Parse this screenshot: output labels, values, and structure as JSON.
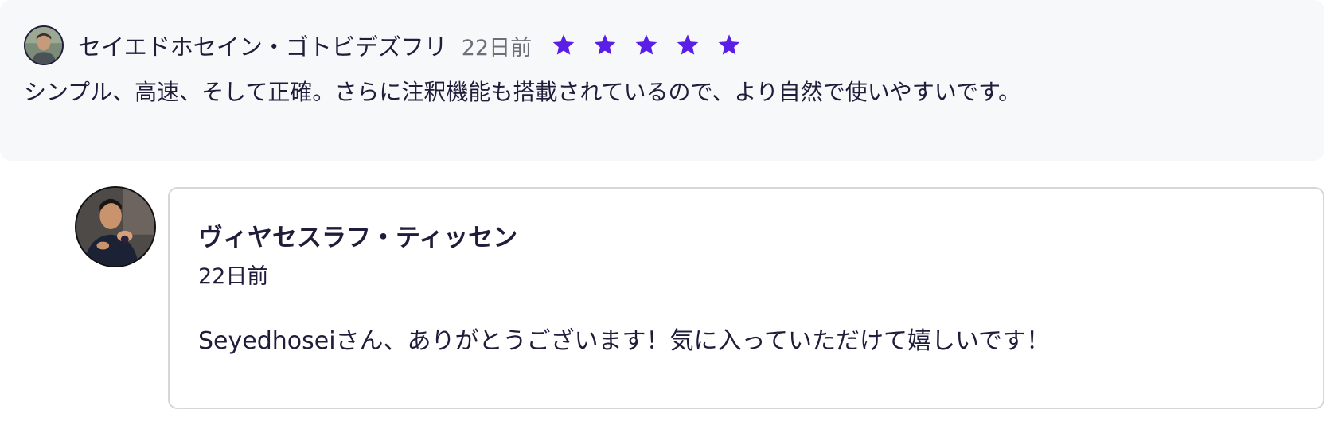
{
  "review": {
    "author": "セイエドホセイン・ゴトビデズフリ",
    "time": "22日前",
    "rating": 5,
    "rating_max": 5,
    "star_color": "#5b1ee6",
    "body": "シンプル、高速、そして正確。さらに注釈機能も搭載されているので、より自然で使いやすいです。"
  },
  "reply": {
    "author": "ヴィヤセスラフ・ティッセン",
    "time": "22日前",
    "body": "Seyedhoseiさん、ありがとうございます！気に入っていただけて嬉しいです！"
  }
}
